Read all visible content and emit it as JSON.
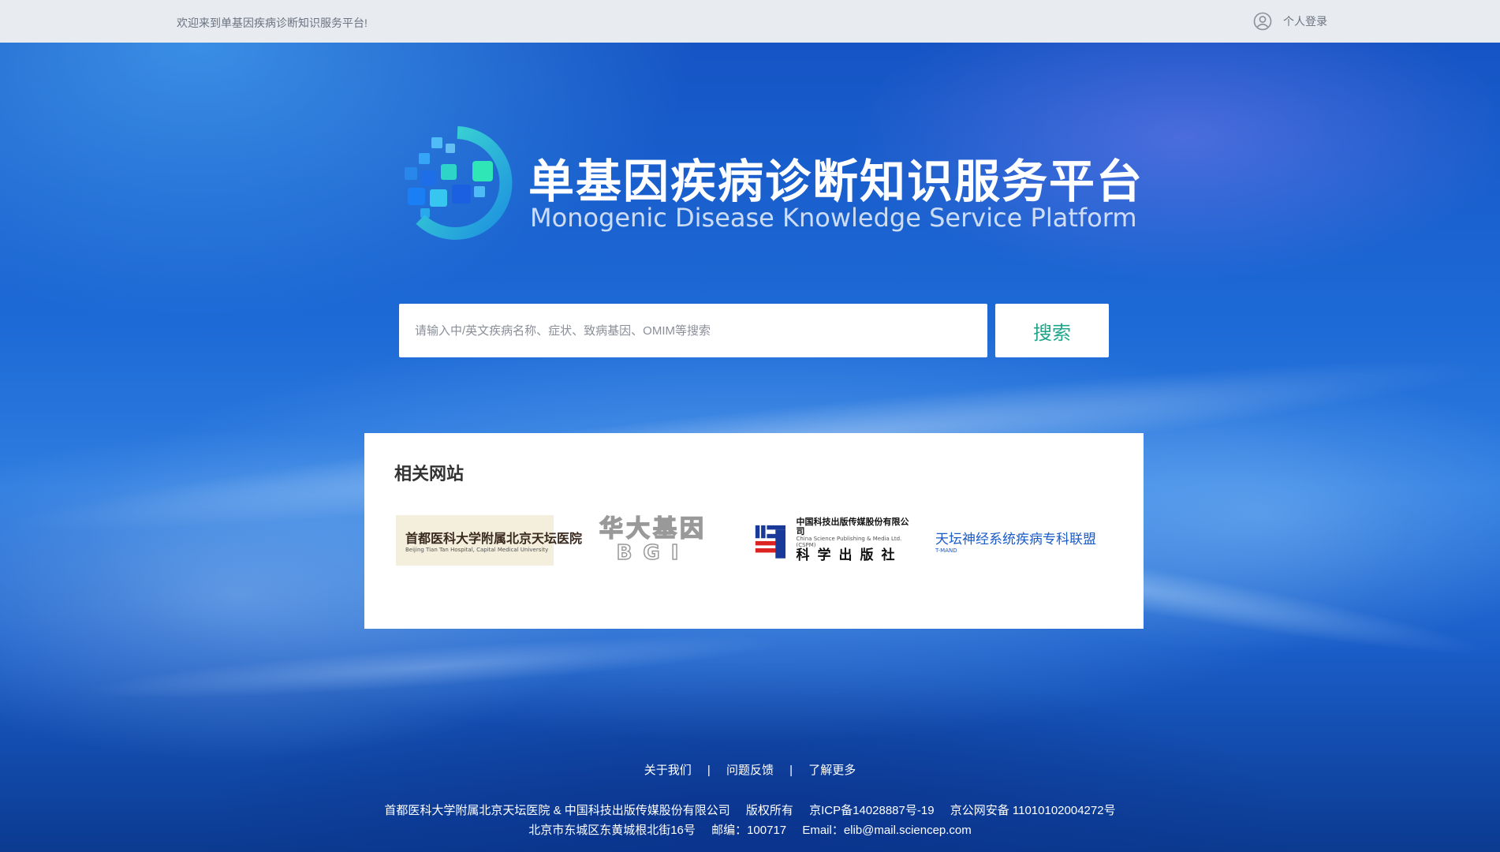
{
  "topbar": {
    "welcome": "欢迎来到单基因疾病诊断知识服务平台!",
    "login_label": "个人登录",
    "login_icon": "user-circle-icon"
  },
  "brand": {
    "title_cn": "单基因疾病诊断知识服务平台",
    "title_en": "Monogenic Disease Knowledge Service Platform",
    "logo_icon": "gene-pixel-logo",
    "colors": {
      "accent_green": "#1ea58a",
      "accent_blue": "#1a6fd8",
      "cyan": "#22d0c8"
    }
  },
  "search": {
    "placeholder": "请输入中/英文疾病名称、症状、致病基因、OMIM等搜索",
    "value": "",
    "button_label": "搜索"
  },
  "related": {
    "title": "相关网站",
    "sites": [
      {
        "name": "首都医科大学附属北京天坛医院",
        "sub": "Beijing Tian Tan Hospital, Capital Medical University"
      },
      {
        "name": "华大基因",
        "sub": "BGI"
      },
      {
        "name": "中国科技出版传媒股份有限公司",
        "sub": "China Science Publishing & Media Ltd. (CSPM)",
        "extra": "科学出版社"
      },
      {
        "name": "天坛神经系统疾病专科联盟",
        "sub": "T-MAND"
      }
    ]
  },
  "footer": {
    "links": [
      "关于我们",
      "问题反馈",
      "了解更多"
    ],
    "separator": "|",
    "copyright": "首都医科大学附属北京天坛医院 & 中国科技出版传媒股份有限公司",
    "rights": "版权所有",
    "icp": "京ICP备14028887号-19",
    "police": "京公网安备 11010102004272号",
    "address": "北京市东城区东黄城根北街16号",
    "postcode": "邮编：100717",
    "email": "Email：elib@mail.sciencep.com"
  }
}
